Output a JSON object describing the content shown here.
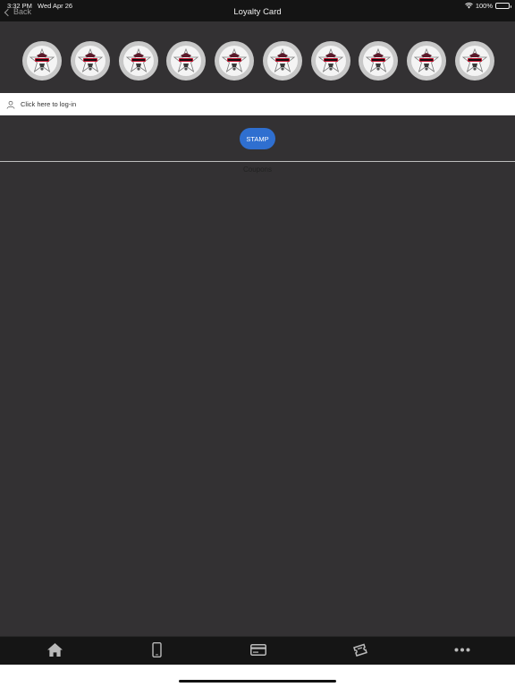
{
  "status_bar": {
    "time": "3:32 PM",
    "date": "Wed Apr 26",
    "battery": "100%",
    "icons": [
      "wifi-icon",
      "battery-icon"
    ]
  },
  "nav": {
    "back_label": "Back",
    "title": "Loyalty Card"
  },
  "stamps": {
    "count": 10,
    "icon": "stamp-logo-icon"
  },
  "login": {
    "label": "Click here to log-in",
    "icon": "user-icon"
  },
  "actions": {
    "stamp_label": "STAMP"
  },
  "coupons": {
    "heading": "Coupons"
  },
  "tab_bar": {
    "tabs": [
      {
        "icon": "home-icon"
      },
      {
        "icon": "phone-icon"
      },
      {
        "icon": "card-icon"
      },
      {
        "icon": "tickets-icon"
      },
      {
        "icon": "more-icon"
      }
    ]
  },
  "colors": {
    "background": "#333133",
    "accent": "#2f6fd0",
    "bar": "#141414"
  }
}
